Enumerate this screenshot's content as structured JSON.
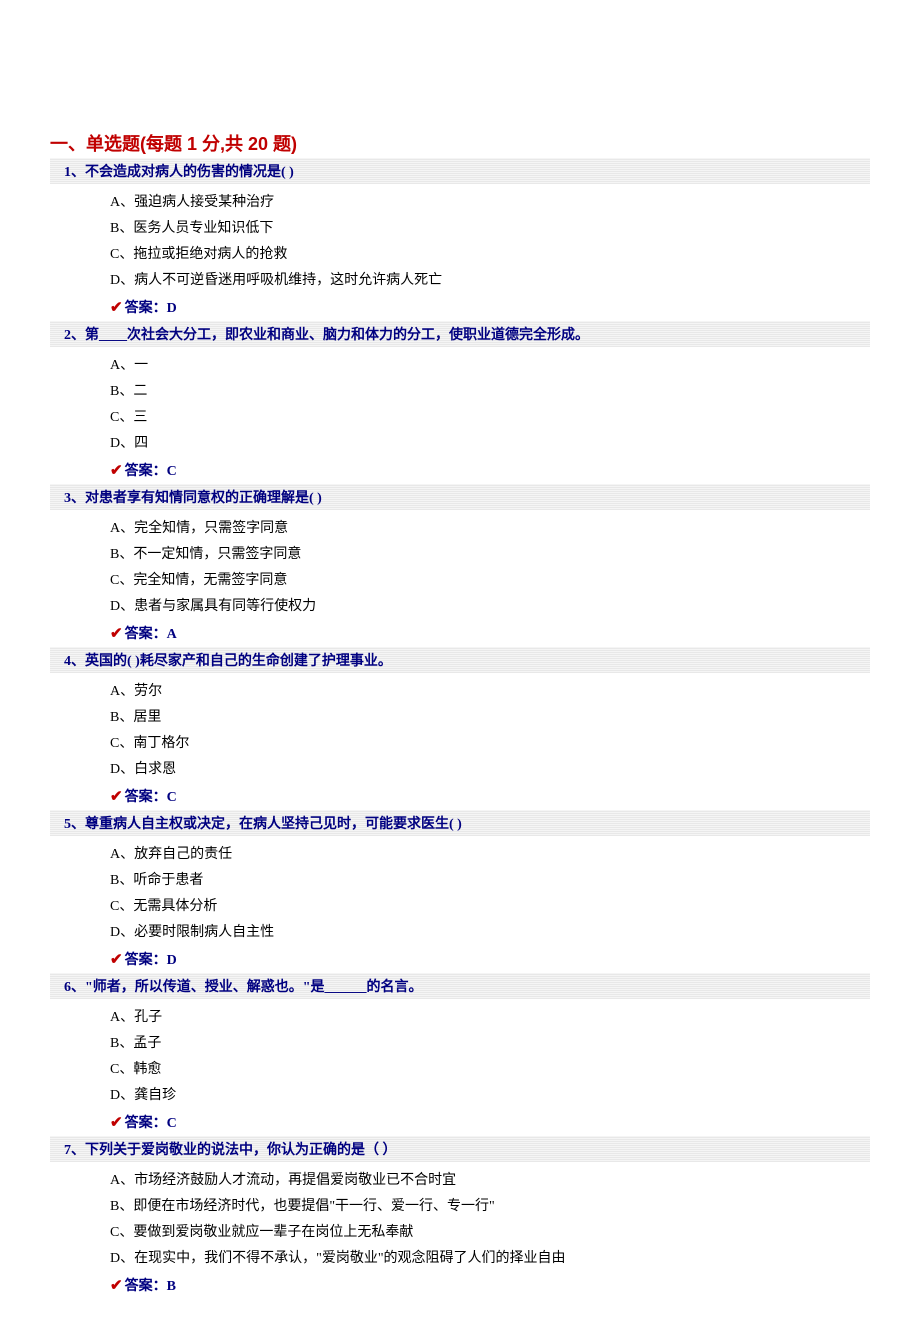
{
  "section": {
    "title": "一、单选题(每题 1 分,共 20 题)"
  },
  "questions": [
    {
      "num": "1、",
      "stem": "不会造成对病人的伤害的情况是(  )",
      "options": [
        "A、强迫病人接受某种治疗",
        "B、医务人员专业知识低下",
        "C、拖拉或拒绝对病人的抢救",
        "D、病人不可逆昏迷用呼吸机维持，这时允许病人死亡"
      ],
      "answer": "答案：D"
    },
    {
      "num": "2、",
      "stem": "第____次社会大分工，即农业和商业、脑力和体力的分工，使职业道德完全形成。",
      "options": [
        "A、一",
        "B、二",
        "C、三",
        "D、四"
      ],
      "answer": "答案：C"
    },
    {
      "num": "3、",
      "stem": "对患者享有知情同意权的正确理解是(  )",
      "options": [
        "A、完全知情，只需签字同意",
        "B、不一定知情，只需签字同意",
        "C、完全知情，无需签字同意",
        "D、患者与家属具有同等行使权力"
      ],
      "answer": "答案：A"
    },
    {
      "num": "4、",
      "stem": "英国的(  )耗尽家产和自己的生命创建了护理事业。",
      "options": [
        "A、劳尔",
        "B、居里",
        "C、南丁格尔",
        "D、白求恩"
      ],
      "answer": "答案：C"
    },
    {
      "num": "5、",
      "stem": "尊重病人自主权或决定，在病人坚持己见时，可能要求医生(  )",
      "options": [
        "A、放弃自己的责任",
        "B、听命于患者",
        "C、无需具体分析",
        "D、必要时限制病人自主性"
      ],
      "answer": "答案：D"
    },
    {
      "num": "6、",
      "stem": "\"师者，所以传道、授业、解惑也。\"是______的名言。",
      "options": [
        "A、孔子",
        "B、孟子",
        "C、韩愈",
        "D、龚自珍"
      ],
      "answer": "答案：C"
    },
    {
      "num": "7、",
      "stem": "下列关于爱岗敬业的说法中，你认为正确的是（  ）",
      "options": [
        "A、市场经济鼓励人才流动，再提倡爱岗敬业已不合时宜",
        "B、即便在市场经济时代，也要提倡\"干一行、爱一行、专一行\"",
        "C、要做到爱岗敬业就应一辈子在岗位上无私奉献",
        "D、在现实中，我们不得不承认，\"爱岗敬业\"的观念阻碍了人们的择业自由"
      ],
      "answer": "答案：B"
    }
  ]
}
